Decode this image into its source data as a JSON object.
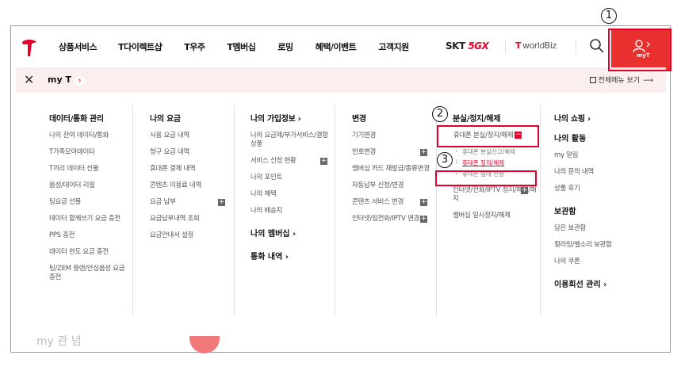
{
  "gnb": {
    "menu": [
      "상품서비스",
      "T다이렉트샵",
      "T우주",
      "T멤버십",
      "로밍",
      "혜택/이벤트",
      "고객지원"
    ],
    "skt_label": "SKT",
    "fivegx_label": "5GX",
    "worldbiz_label": "worldBiz",
    "myt_button_label": "myT"
  },
  "subbar": {
    "close": "✕",
    "myt": "my T",
    "full_menu": "전체메뉴 보기"
  },
  "columns": {
    "c1": {
      "heading": "데이터/통화 관리",
      "items": [
        "나의 잔여 데이터/통화",
        "T가족모아데이터",
        "T끼리 데이터 선물",
        "음성/데이터 리필",
        "팅요금 선물",
        "데이터 함께쓰기 요금 충전",
        "PPS 충전",
        "데이터 한도 요금 충전",
        "팅/ZEM 플랜/안심음성 요금 충전"
      ]
    },
    "c2": {
      "heading": "나의 요금",
      "items": [
        "사용 요금 내역",
        "청구 요금 내역",
        "휴대폰 결제 내역",
        "콘텐츠 이용료 내역",
        "요금 납부",
        "요금납부내역 조회",
        "요금안내서 설정"
      ]
    },
    "c3": {
      "heading": "나의 가입정보",
      "items": [
        "나의 요금제/부가서비스/결합상품",
        "서비스 신청 현황",
        "나의 포인트",
        "나의 혜택",
        "나의 배송지"
      ],
      "heading2": "나의 멤버십",
      "heading3": "통화 내역"
    },
    "c4": {
      "heading": "변경",
      "items": [
        "기기변경",
        "번호변경",
        "멤버십 카드 재발급/종류변경",
        "자동납부 신청/변경",
        "콘텐츠 서비스 변경",
        "인터넷/집전화/IPTV 변경"
      ]
    },
    "c5": {
      "heading": "분실/정지/해제",
      "expanded": "휴대폰 분실/정지/해제",
      "subs": [
        "휴대폰 분실신고/해제",
        "휴대폰 정지/해제",
        "휴대폰 임대 신청"
      ],
      "items": [
        "인터넷/전화/IPTV 정지/해제/해지",
        "멤버십 일시정지/해제"
      ]
    },
    "c6": {
      "heading": "나의 쇼핑",
      "heading2": "나의 활동",
      "items_a": [
        "my 알림",
        "나의 문의 내역",
        "상품 후기"
      ],
      "heading3": "보관함",
      "items_b": [
        "담은 보관함",
        "컬러링/벨소리 보관함",
        "나의 쿠폰"
      ],
      "heading4": "이용회선 관리"
    }
  },
  "annotations": [
    "1",
    "2",
    "3"
  ],
  "background_text": "my 관 념",
  "colors": {
    "brand_red": "#e4002b",
    "myt_button": "#e8312f",
    "subbar_bg": "#fbeeee"
  }
}
